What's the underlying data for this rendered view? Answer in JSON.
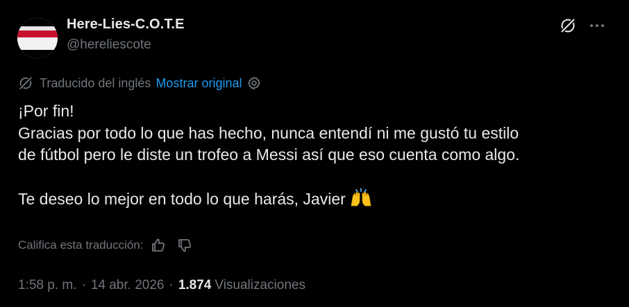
{
  "header": {
    "display_name": "Here-Lies-C.O.T.E",
    "handle": "@hereliescote"
  },
  "translation": {
    "label": "Traducido del inglés",
    "show_original": "Mostrar original"
  },
  "tweet": {
    "lines": [
      "¡Por fin!",
      "Gracias por todo lo que has hecho, nunca entendí ni me gustó tu estilo",
      "de fútbol pero le diste un trofeo a Messi así que eso cuenta como algo.",
      "Te deseo lo mejor en todo lo que harás, Javier"
    ],
    "emoji": "raising-hands-icon"
  },
  "rating": {
    "label": "Califica esta traducción:"
  },
  "meta": {
    "time": "1:58 p. m.",
    "separator": "·",
    "date": "14 abr. 2026",
    "views_count": "1.874",
    "views_label": "Visualizaciones"
  },
  "colors": {
    "background": "#000000",
    "text_primary": "#e7e9ea",
    "text_secondary": "#71767b",
    "link": "#1d9bf0"
  }
}
